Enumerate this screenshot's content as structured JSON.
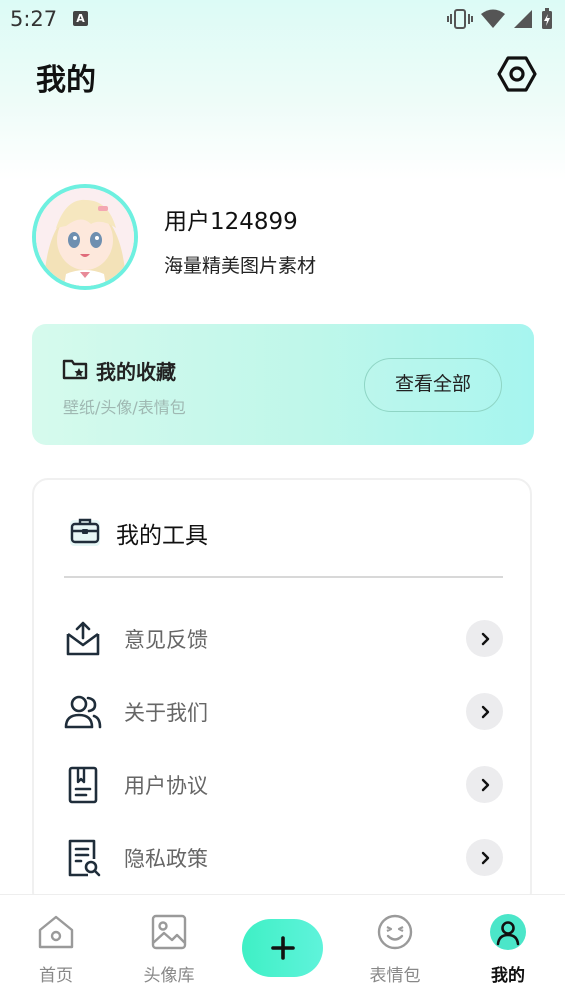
{
  "status_bar": {
    "time": "5:27",
    "notification_badge": "A",
    "icons": [
      "vibrate-icon",
      "wifi-icon",
      "signal-icon",
      "battery-icon"
    ]
  },
  "header": {
    "title": "我的",
    "settings_icon": "settings-hexagon-icon"
  },
  "profile": {
    "username": "用户124899",
    "tagline": "海量精美图片素材"
  },
  "favorites": {
    "title": "我的收藏",
    "subtitle": "壁纸/头像/表情包",
    "view_all_label": "查看全部",
    "icon": "folder-star-icon"
  },
  "tools": {
    "title": "我的工具",
    "icon": "toolbox-icon",
    "items": [
      {
        "label": "意见反馈",
        "icon": "feedback-upload-icon"
      },
      {
        "label": "关于我们",
        "icon": "users-icon"
      },
      {
        "label": "用户协议",
        "icon": "agreement-book-icon"
      },
      {
        "label": "隐私政策",
        "icon": "privacy-doc-search-icon"
      }
    ]
  },
  "bottom_nav": {
    "items": [
      {
        "label": "首页",
        "icon": "home-icon"
      },
      {
        "label": "头像库",
        "icon": "image-icon"
      },
      {
        "label": "表情包",
        "icon": "smiley-icon"
      },
      {
        "label": "我的",
        "icon": "user-icon",
        "active": true
      }
    ],
    "add_icon": "plus-icon"
  },
  "colors": {
    "accent": "#3ff0c5",
    "avatar_ring": "#6ef0e0",
    "fav_card_start": "#d6faed",
    "fav_card_end": "#a6f5ef"
  }
}
